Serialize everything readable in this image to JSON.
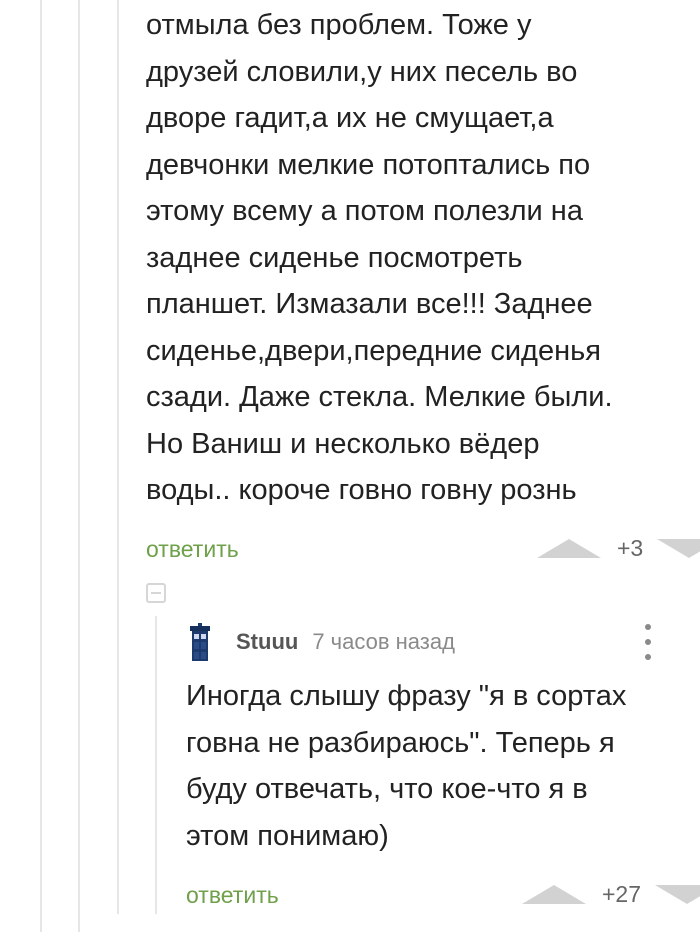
{
  "comment_1": {
    "lines": [
      "отмыла без проблем. Тоже у",
      "друзей словили,у них песель во",
      "дворе гадит,а их не смущает,а",
      "девчонки мелкие потоптались по",
      "этому всему а потом полезли на",
      "заднее сиденье посмотреть",
      "планшет. Измазали все!!! Заднее",
      "сиденье,двери,передние сиденья",
      "сзади. Даже стекла. Мелкие были.",
      "Но Ваниш и несколько вёдер",
      "воды.. короче говно говну рознь"
    ],
    "reply_label": "ответить",
    "score": "+3"
  },
  "comment_2": {
    "username": "Stuuu",
    "timestamp": "7 часов назад",
    "avatar_icon": "police-box-icon",
    "lines": [
      "Иногда слышу фразу \"я в сортах",
      "говна не разбираюсь\". Теперь я",
      "буду отвечать, что кое-что я в",
      "этом понимаю)"
    ],
    "reply_label": "ответить",
    "score": "+27"
  },
  "colors": {
    "reply_link": "#6fa04a",
    "vote_arrow": "#d2d2d2",
    "thread_line": "#e6e6e6",
    "avatar": "#1c3a6e"
  }
}
